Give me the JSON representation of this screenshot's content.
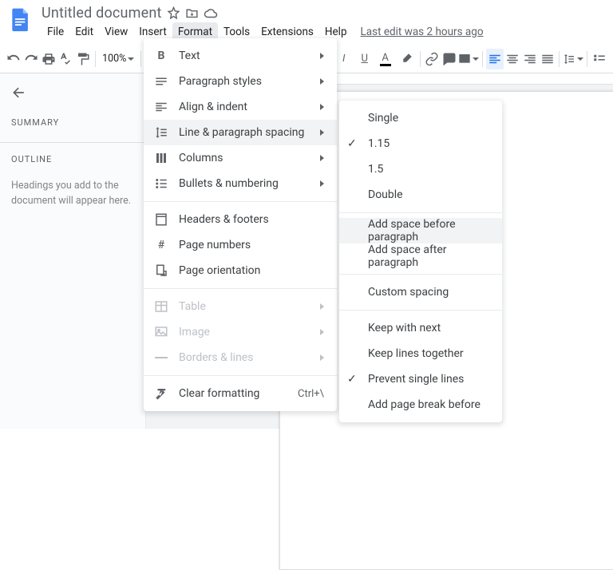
{
  "title": "Untitled document",
  "menubar": [
    "File",
    "Edit",
    "View",
    "Insert",
    "Format",
    "Tools",
    "Extensions",
    "Help"
  ],
  "active_menu_index": 4,
  "last_edit": "Last edit was 2 hours ago",
  "zoom": "100%",
  "sidebar": {
    "summary_title": "SUMMARY",
    "outline_title": "OUTLINE",
    "outline_hint": "Headings you add to the document will appear here."
  },
  "format_menu": {
    "items": [
      {
        "label": "Text",
        "sub": true
      },
      {
        "label": "Paragraph styles",
        "sub": true
      },
      {
        "label": "Align & indent",
        "sub": true
      },
      {
        "label": "Line & paragraph spacing",
        "sub": true,
        "highlight": true
      },
      {
        "label": "Columns",
        "sub": true
      },
      {
        "label": "Bullets & numbering",
        "sub": true
      }
    ],
    "section2": [
      {
        "label": "Headers & footers"
      },
      {
        "label": "Page numbers"
      },
      {
        "label": "Page orientation"
      }
    ],
    "section3": [
      {
        "label": "Table",
        "sub": true,
        "disabled": true
      },
      {
        "label": "Image",
        "sub": true,
        "disabled": true
      },
      {
        "label": "Borders & lines",
        "sub": true,
        "disabled": true
      }
    ],
    "section4": [
      {
        "label": "Clear formatting",
        "shortcut": "Ctrl+\\"
      }
    ]
  },
  "spacing_submenu": {
    "group1": [
      "Single",
      "1.15",
      "1.5",
      "Double"
    ],
    "selected": 1,
    "group2": [
      "Add space before paragraph",
      "Add space after paragraph"
    ],
    "g2_highlight": 0,
    "group3": [
      "Custom spacing"
    ],
    "group4": [
      "Keep with next",
      "Keep lines together",
      "Prevent single lines",
      "Add page break before"
    ],
    "g4_checked": [
      2
    ]
  }
}
